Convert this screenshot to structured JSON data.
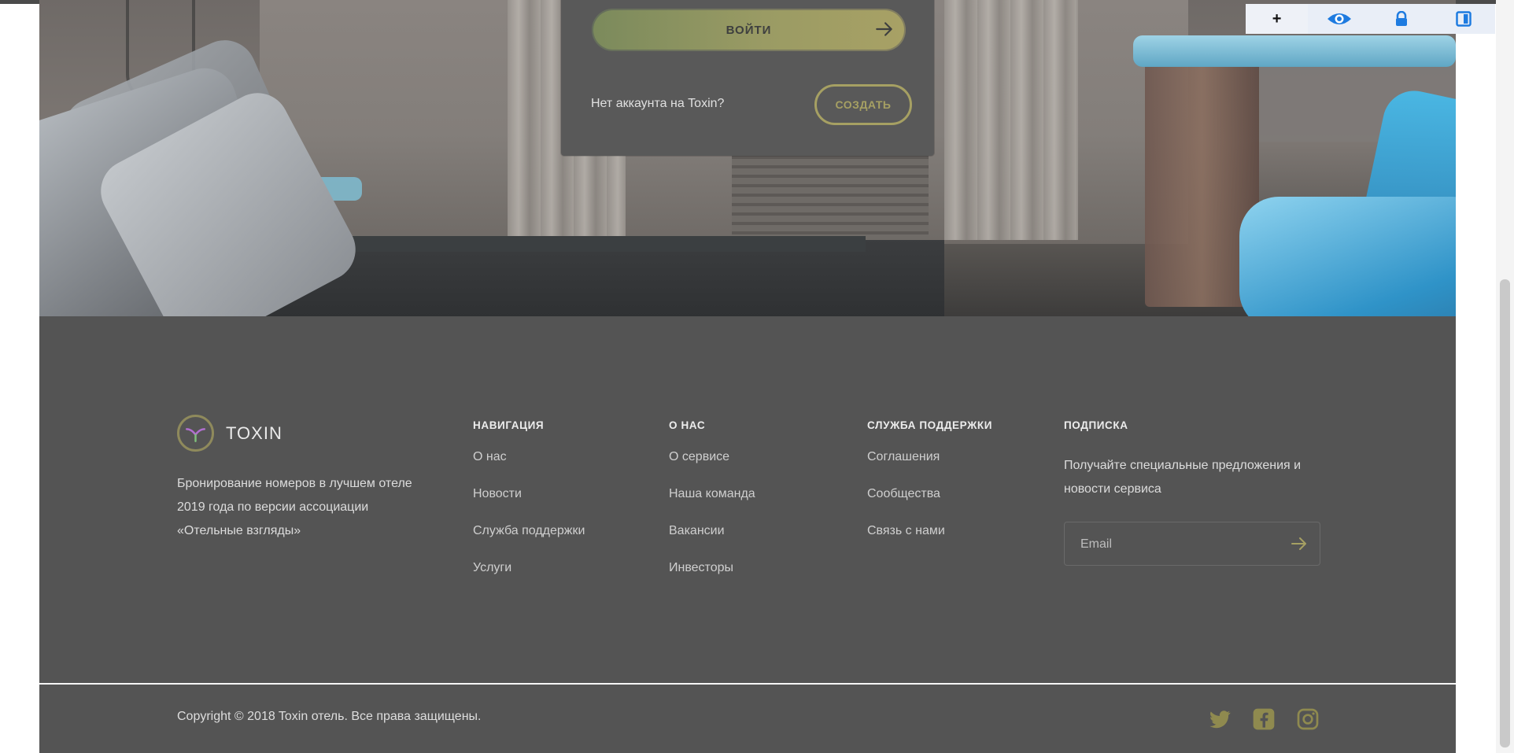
{
  "login_card": {
    "login_label": "ВОЙТИ",
    "no_account_text": "Нет аккаунта на Toxin?",
    "create_label": "СОЗДАТЬ"
  },
  "footer": {
    "logo_text": "TOXIN",
    "about": "Бронирование номеров в лучшем отеле 2019 года по версии ассоциации «Отельные взгляды»",
    "columns": [
      {
        "title": "НАВИГАЦИЯ",
        "links": [
          "О нас",
          "Новости",
          "Служба поддержки",
          "Услуги"
        ]
      },
      {
        "title": "О НАС",
        "links": [
          "О сервисе",
          "Наша команда",
          "Вакансии",
          "Инвесторы"
        ]
      },
      {
        "title": "СЛУЖБА ПОДДЕРЖКИ",
        "links": [
          "Соглашения",
          "Сообщества",
          "Связь с нами"
        ]
      }
    ],
    "subscription": {
      "title": "ПОДПИСКА",
      "text": "Получайте специальные предложения и новости сервиса",
      "email_placeholder": "Email"
    },
    "copyright": "Copyright © 2018 Toxin отель. Все права защищены."
  },
  "social_icons": [
    "twitter-icon",
    "facebook-icon",
    "instagram-icon"
  ],
  "extension_toolbar": {
    "buttons": [
      "plus-icon",
      "eye-icon",
      "lock-icon",
      "contrast-icon"
    ],
    "accent_color": "#1e7be0"
  },
  "colors": {
    "footer_bg": "#545454",
    "accent_olive": "#a6a063"
  }
}
